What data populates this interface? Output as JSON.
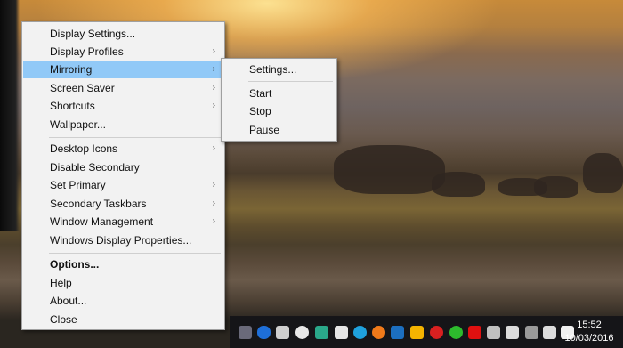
{
  "main_menu": {
    "items": [
      {
        "label": "Display Settings...",
        "submenu": false
      },
      {
        "label": "Display Profiles",
        "submenu": true
      },
      {
        "label": "Mirroring",
        "submenu": true,
        "highlighted": true
      },
      {
        "label": "Screen Saver",
        "submenu": true
      },
      {
        "label": "Shortcuts",
        "submenu": true
      },
      {
        "label": "Wallpaper...",
        "submenu": false
      },
      {
        "label": "Desktop Icons",
        "submenu": true
      },
      {
        "label": "Disable Secondary",
        "submenu": false
      },
      {
        "label": "Set Primary",
        "submenu": true
      },
      {
        "label": "Secondary Taskbars",
        "submenu": true
      },
      {
        "label": "Window Management",
        "submenu": true
      },
      {
        "label": "Windows Display Properties...",
        "submenu": false
      },
      {
        "label": "Options...",
        "submenu": false,
        "bold": true
      },
      {
        "label": "Help",
        "submenu": false
      },
      {
        "label": "About...",
        "submenu": false
      },
      {
        "label": "Close",
        "submenu": false
      }
    ],
    "submenu_arrow": "›"
  },
  "mirroring_submenu": {
    "items": [
      {
        "label": "Settings..."
      },
      {
        "label": "Start"
      },
      {
        "label": "Stop"
      },
      {
        "label": "Pause"
      }
    ]
  },
  "taskbar": {
    "icons": [
      "dropbox-like-app-icon",
      "bluetooth-icon",
      "pen-icon",
      "cloud-icon",
      "monitor-app-icon",
      "skype-icon",
      "edge-like-icon",
      "upload-icon",
      "outlook-icon",
      "google-drive-icon",
      "network-dots-icon",
      "green-app-icon",
      "red-app-icon",
      "pocket-icon",
      "dropbox-icon",
      "show-desktop-icon",
      "volume-icon",
      "action-center-icon"
    ],
    "clock_time": "15:52",
    "clock_date": "10/03/2016"
  },
  "colors": {
    "menu_bg": "#f2f2f2",
    "highlight": "#91c9f7",
    "taskbar": "#141418"
  }
}
